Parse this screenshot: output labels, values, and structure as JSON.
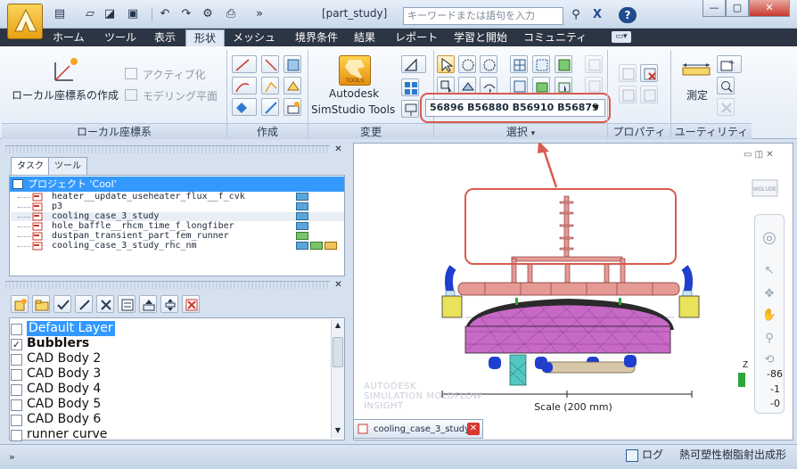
{
  "title_bar": {
    "document_title": "[part_study]",
    "search_placeholder": "キーワードまたは語句を入力",
    "icons": [
      "new-file-icon",
      "open-folder-icon",
      "save-icon",
      "undo-icon",
      "redo-icon",
      "print-icon",
      "binoculars-icon",
      "close-x-icon",
      "help-icon"
    ]
  },
  "tabs": [
    "ホーム",
    "ツール",
    "表示",
    "形状",
    "メッシュ",
    "境界条件",
    "結果",
    "レポート",
    "学習と開始",
    "コミュニティ"
  ],
  "active_tab": "形状",
  "ribbon": {
    "local_coords": {
      "button": "ローカル座標系の作成",
      "activate": "アクティブ化",
      "modeling_plane": "モデリング平面",
      "panel_label": "ローカル座標系"
    },
    "create_panel_label": "作成",
    "modify": {
      "button_line1": "Autodesk",
      "button_line2": "SimStudio Tools",
      "icon_label": "TOOLS",
      "panel_label": "変更"
    },
    "select": {
      "combo_value": "56896 B56880 B56910 B56879",
      "panel_label": "選択"
    },
    "properties_panel_label": "プロパティ",
    "utility": {
      "measure": "測定",
      "panel_label": "ユーティリティ"
    }
  },
  "task_pane": {
    "tabs": [
      "タスク",
      "ツール"
    ],
    "project": "プロジェクト 'Cool'",
    "items": [
      "heater__update_useheater_flux__f_cvk",
      "p3",
      "cooling_case_3_study",
      "hole_baffle__rhcm_time_f_longfiber",
      "dustpan_transient_part_fem_runner",
      "cooling_case_3_study_rhc_nm"
    ]
  },
  "layers": [
    {
      "name": "Default Layer",
      "checked": false,
      "selected": true,
      "bold": false
    },
    {
      "name": "Bubblers",
      "checked": true,
      "selected": false,
      "bold": true
    },
    {
      "name": "CAD Body 2",
      "checked": false,
      "selected": false,
      "bold": false
    },
    {
      "name": "CAD Body 3",
      "checked": false,
      "selected": false,
      "bold": false
    },
    {
      "name": "CAD Body 4",
      "checked": false,
      "selected": false,
      "bold": false
    },
    {
      "name": "CAD Body 5",
      "checked": false,
      "selected": false,
      "bold": false
    },
    {
      "name": "CAD Body 6",
      "checked": false,
      "selected": false,
      "bold": false
    },
    {
      "name": "runner curve",
      "checked": false,
      "selected": false,
      "bold": false
    }
  ],
  "viewport": {
    "watermark_line1": "AUTODESK",
    "watermark_line2": "SIMULATION MOLDFLOW",
    "watermark_line3": "INSIGHT",
    "scale": "Scale (200 mm)",
    "axis_labels": [
      "-86",
      "-1",
      "-0"
    ],
    "axis_letter": "Z",
    "viewcube_label": "WGLUDE",
    "tab_name": "cooling_case_3_study"
  },
  "status_bar": {
    "left": "»",
    "log": "ログ",
    "mode": "熱可塑性樹脂射出成形"
  },
  "colors": {
    "accent_blue": "#3399ff",
    "highlight_red": "#d95a4e",
    "mesh_magenta": "#c869c8",
    "channel_pink": "#e59a95"
  }
}
